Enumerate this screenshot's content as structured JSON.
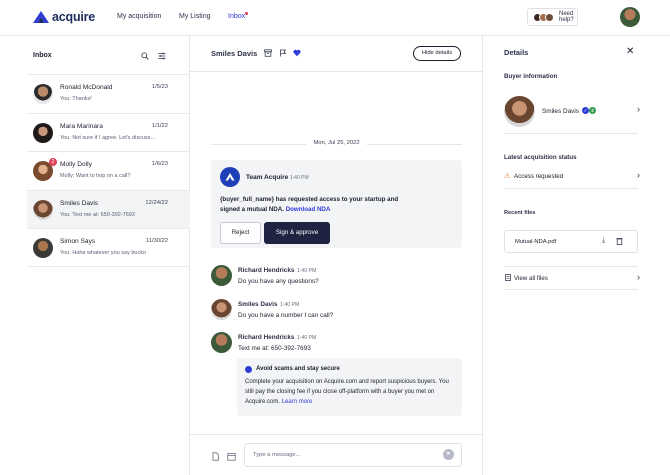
{
  "header": {
    "brand": "acquire",
    "nav": [
      {
        "label": "My acquisition"
      },
      {
        "label": "My Listing"
      },
      {
        "label": "Inbox"
      }
    ],
    "help_label": "Need help?",
    "accent": "#2f3bd6"
  },
  "inbox": {
    "title": "Inbox",
    "conversations": [
      {
        "name": "Ronald McDonald",
        "date": "1/5/23",
        "preview": "You: Thanks!"
      },
      {
        "name": "Mara Marinara",
        "date": "1/1/22",
        "preview": "You: Not sure if I agree. Let's discuss..."
      },
      {
        "name": "Molly Dolly",
        "date": "1/6/23",
        "preview": "Molly: Want to hop on a call?",
        "badge": "2"
      },
      {
        "name": "Smiles Davis",
        "date": "12/24/22",
        "preview": "You: Text me at: 650-392-7693"
      },
      {
        "name": "Simon Says",
        "date": "11/30/22",
        "preview": "You: Haha whatever you say bucko"
      }
    ]
  },
  "chat": {
    "title": "Smiles Davis",
    "hide_details": "Hide details",
    "date_divider": "Mon, Jul 25, 2022",
    "system": {
      "sender": "Team Acquire",
      "time": "1:40 PM",
      "text": "{buyer_full_name} has requested access to your startup and signed a mutual NDA.",
      "link": "Download NDA",
      "reject": "Reject",
      "approve": "Sign & approve"
    },
    "messages": [
      {
        "sender": "Richard Hendricks",
        "time": "1:40 PM",
        "text": "Do you have any questions?"
      },
      {
        "sender": "Smiles Davis",
        "time": "1:40 PM",
        "text": "Do you have a number I can call?"
      },
      {
        "sender": "Richard Hendricks",
        "time": "1:40 PM",
        "text": "Text me at: 650-392-7693"
      }
    ],
    "safety": {
      "title": "Avoid scams and stay secure",
      "text": "Complete your acquisition on Acquire.com and report suspicious buyers. You still pay the closing fee if you close off-platform with a buyer you met on Acquire.com.",
      "link": "Learn more"
    },
    "compose_placeholder": "Type a message..."
  },
  "details": {
    "title": "Details",
    "buyer_heading": "Buyer information",
    "buyer_name": "Smiles Davis",
    "status_heading": "Latest acquisition status",
    "status": "Access requested",
    "files_heading": "Recent files",
    "file_name": "Mutual-NDA.pdf",
    "view_all": "View all files"
  }
}
